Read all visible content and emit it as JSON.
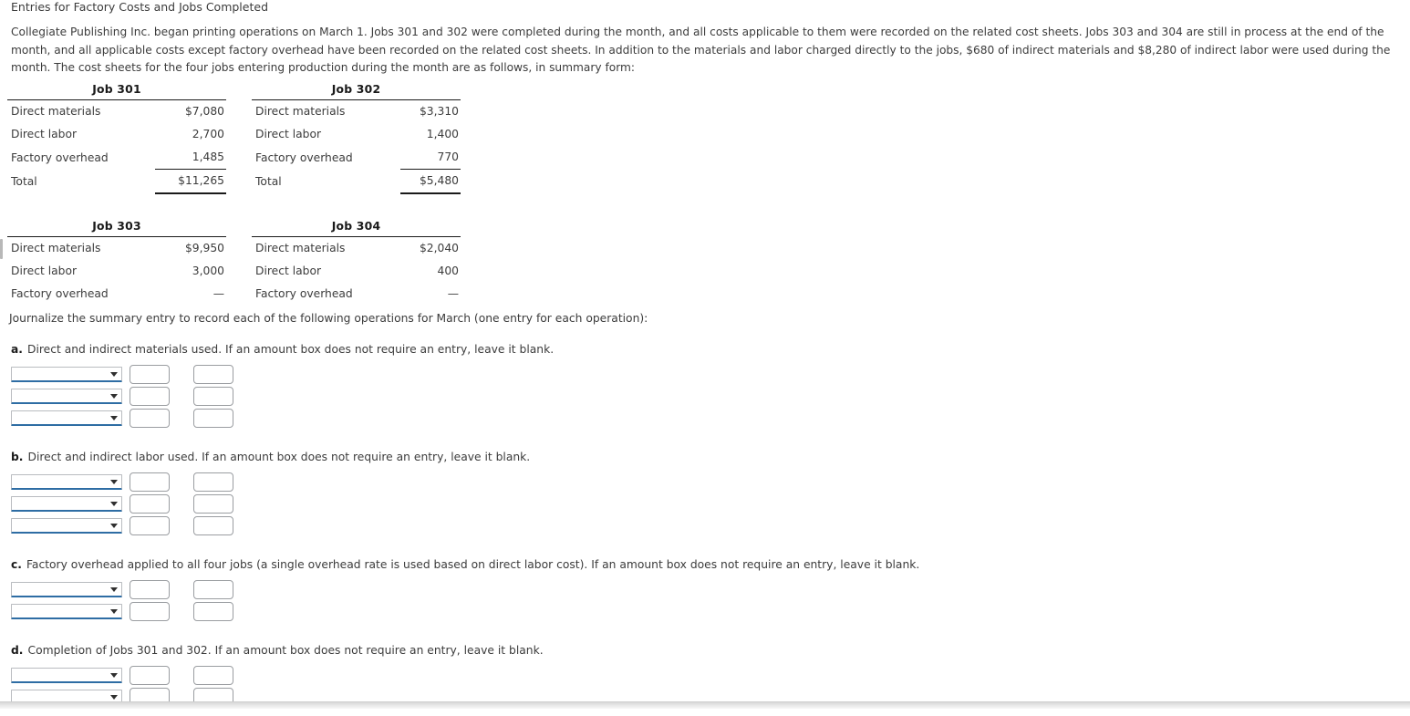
{
  "exercise": {
    "title": "Entries for Factory Costs and Jobs Completed",
    "intro": "Collegiate Publishing Inc. began printing operations on March 1. Jobs 301 and 302 were completed during the month, and all costs applicable to them were recorded on the related cost sheets. Jobs 303 and 304 are still in process at the end of the month, and all applicable costs except factory overhead have been recorded on the related cost sheets. In addition to the materials and labor charged directly to the jobs, $680 of indirect materials and $8,280 of indirect labor were used during the month. The cost sheets for the four jobs entering production during the month are as follows, in summary form:",
    "journalize_prompt": "Journalize the summary entry to record each of the following operations for March (one entry for each operation):"
  },
  "jobs": [
    {
      "title": "Job 301",
      "rows": [
        {
          "label": "Direct materials",
          "amount": "$7,080"
        },
        {
          "label": "Direct labor",
          "amount": "2,700"
        },
        {
          "label": "Factory overhead",
          "amount": "1,485"
        }
      ],
      "total": {
        "label": "Total",
        "amount": "$11,265"
      }
    },
    {
      "title": "Job 302",
      "rows": [
        {
          "label": "Direct materials",
          "amount": "$3,310"
        },
        {
          "label": "Direct labor",
          "amount": "1,400"
        },
        {
          "label": "Factory overhead",
          "amount": "770"
        }
      ],
      "total": {
        "label": "Total",
        "amount": "$5,480"
      }
    },
    {
      "title": "Job 303",
      "rows": [
        {
          "label": "Direct materials",
          "amount": "$9,950"
        },
        {
          "label": "Direct labor",
          "amount": "3,000"
        },
        {
          "label": "Factory overhead",
          "amount": "—"
        }
      ],
      "total": null
    },
    {
      "title": "Job 304",
      "rows": [
        {
          "label": "Direct materials",
          "amount": "$2,040"
        },
        {
          "label": "Direct labor",
          "amount": "400"
        },
        {
          "label": "Factory overhead",
          "amount": "—"
        }
      ],
      "total": null
    }
  ],
  "requirements": [
    {
      "letter": "a.",
      "text": "Direct and indirect materials used. If an amount box does not require an entry, leave it blank.",
      "row_count": 3,
      "entries": [
        {
          "account": "",
          "debit": "",
          "credit": ""
        },
        {
          "account": "",
          "debit": "",
          "credit": ""
        },
        {
          "account": "",
          "debit": "",
          "credit": ""
        }
      ]
    },
    {
      "letter": "b.",
      "text": "Direct and indirect labor used. If an amount box does not require an entry, leave it blank.",
      "row_count": 3,
      "entries": [
        {
          "account": "",
          "debit": "",
          "credit": ""
        },
        {
          "account": "",
          "debit": "",
          "credit": ""
        },
        {
          "account": "",
          "debit": "",
          "credit": ""
        }
      ]
    },
    {
      "letter": "c.",
      "text": "Factory overhead applied to all four jobs (a single overhead rate is used based on direct labor cost). If an amount box does not require an entry, leave it blank.",
      "row_count": 2,
      "entries": [
        {
          "account": "",
          "debit": "",
          "credit": ""
        },
        {
          "account": "",
          "debit": "",
          "credit": ""
        }
      ]
    },
    {
      "letter": "d.",
      "text": "Completion of Jobs 301 and 302. If an amount box does not require an entry, leave it blank.",
      "row_count": 2,
      "entries": [
        {
          "account": "",
          "debit": "",
          "credit": ""
        },
        {
          "account": "",
          "debit": "",
          "credit": ""
        }
      ]
    }
  ],
  "controls": {
    "dropdown_placeholder": "",
    "amount_placeholder": "",
    "caret_icon": "chevron-down-icon"
  },
  "colors": {
    "text": "#3c3c3c",
    "rule": "#1a1a1a",
    "select_underline": "#2e6da4",
    "box_border": "#9a9da1",
    "scrollbar": "#d7d7d7"
  },
  "layout": {
    "requirement_tops": [
      376,
      494,
      612,
      706
    ],
    "job_card_tops": [
      90,
      240
    ]
  }
}
